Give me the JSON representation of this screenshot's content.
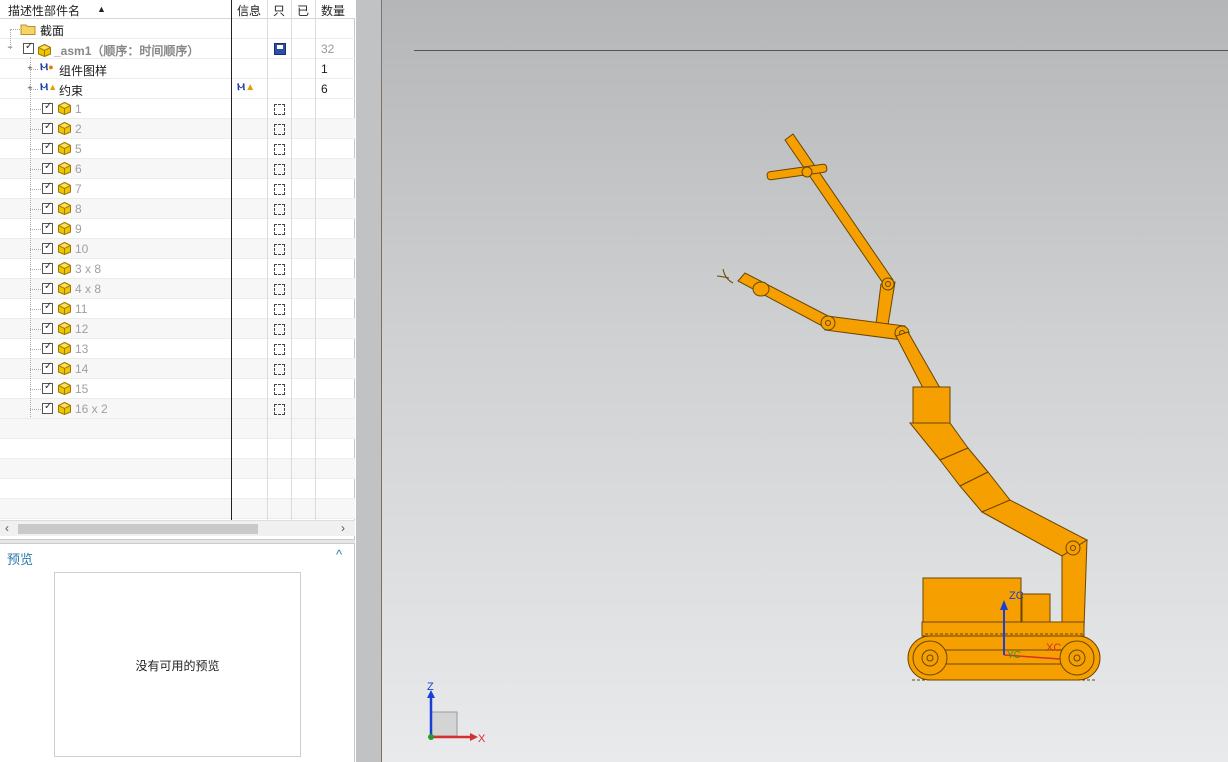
{
  "tree": {
    "columns": {
      "name": "描述性部件名",
      "info": "信息",
      "readonly": "只",
      "done": "已",
      "qty": "数量"
    },
    "section_row": {
      "label": "截面"
    },
    "assembly_row": {
      "label": "_asm1（顺序：时间顺序）",
      "qty": "32"
    },
    "group_rows": [
      {
        "label": "组件图样",
        "qty": "1",
        "icon": "component-pattern-icon"
      },
      {
        "label": "约束",
        "qty": "6",
        "icon": "constraint-icon"
      }
    ],
    "parts": [
      {
        "label": "1"
      },
      {
        "label": "2"
      },
      {
        "label": "5"
      },
      {
        "label": "6"
      },
      {
        "label": "7"
      },
      {
        "label": "8"
      },
      {
        "label": "9"
      },
      {
        "label": "10"
      },
      {
        "label": "3 x 8"
      },
      {
        "label": "4 x 8"
      },
      {
        "label": "11"
      },
      {
        "label": "12"
      },
      {
        "label": "13"
      },
      {
        "label": "14"
      },
      {
        "label": "15"
      },
      {
        "label": "16 x 2"
      }
    ]
  },
  "preview": {
    "title": "预览",
    "empty_message": "没有可用的预览"
  },
  "viewport": {
    "triad_labels": {
      "z": "Z",
      "x": "X"
    },
    "datum_labels": {
      "zc": "ZC",
      "xc": "XC",
      "yc": "YC"
    },
    "model_color": "#f5a000"
  }
}
